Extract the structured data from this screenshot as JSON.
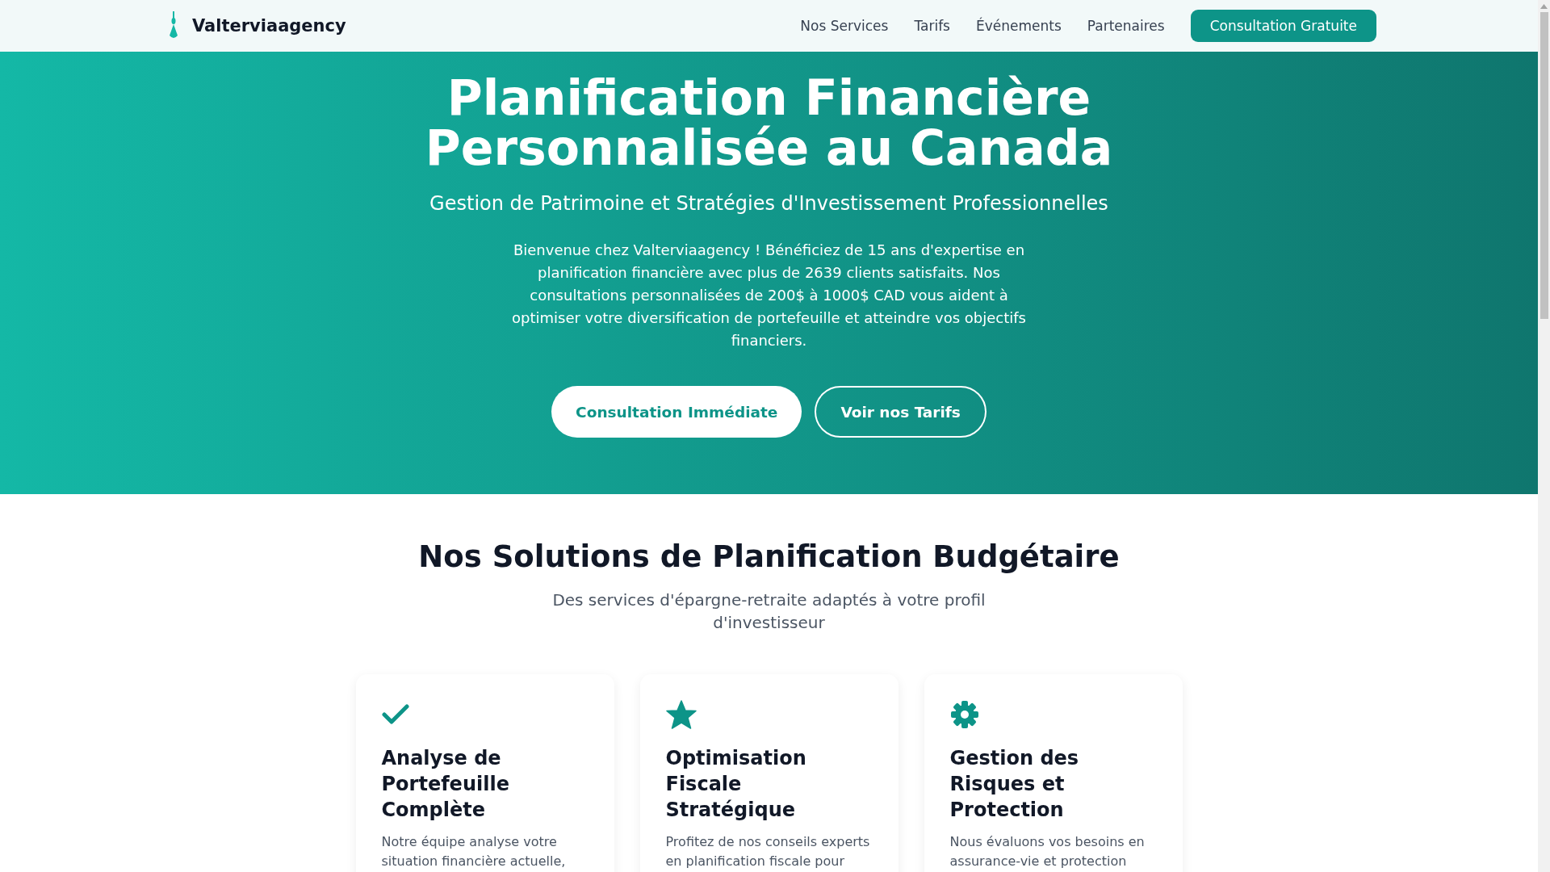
{
  "header": {
    "brand": "Valterviaagency",
    "nav": [
      {
        "label": "Nos Services"
      },
      {
        "label": "Tarifs"
      },
      {
        "label": "Événements"
      },
      {
        "label": "Partenaires"
      }
    ],
    "cta": "Consultation Gratuite"
  },
  "hero": {
    "title_lines": [
      "Planification Financière",
      "Personnalisée au Canada"
    ],
    "subtitle": "Gestion de Patrimoine et Stratégies d'Investissement Professionnelles",
    "intro": "Bienvenue chez Valterviaagency ! Bénéficiez de 15 ans d'expertise en planification financière avec plus de 2639 clients satisfaits. Nos consultations personnalisées de 200$ à 1000$ CAD vous aident à optimiser votre diversification de portefeuille et atteindre vos objectifs financiers.",
    "buttons": [
      {
        "label": "Consultation Immédiate",
        "kind": "solid"
      },
      {
        "label": "Voir nos Tarifs",
        "kind": "outline"
      }
    ]
  },
  "solutions": {
    "title": "Nos Solutions de Planification Budgétaire",
    "subtitle": "Des services d'épargne-retraite adaptés à votre profil d'investisseur",
    "cards": [
      {
        "kind": "check",
        "title": "Analyse de Portefeuille Complète",
        "text": "Notre équipe analyse votre situation financière actuelle,"
      },
      {
        "kind": "star",
        "title": "Optimisation Fiscale Stratégique",
        "text": "Profitez de nos conseils experts en planification fiscale pour"
      },
      {
        "kind": "gear",
        "title": "Gestion des Risques et Protection",
        "text": "Nous évaluons vos besoins en assurance-vie et protection"
      }
    ]
  }
}
